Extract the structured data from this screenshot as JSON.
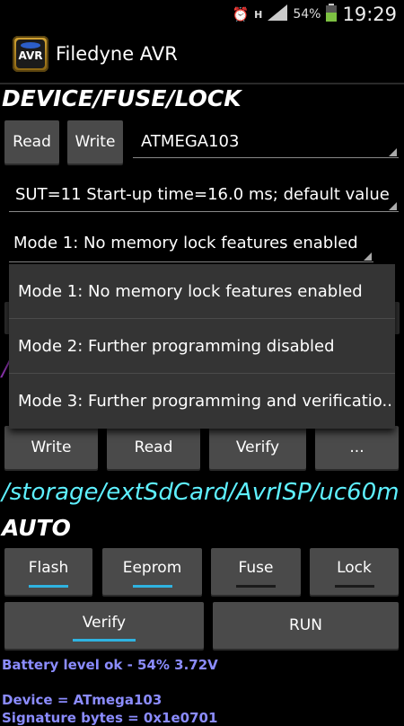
{
  "status": {
    "battery": "54%",
    "time": "19:29"
  },
  "app": {
    "title": "Filedyne AVR",
    "icon_text": "AVR"
  },
  "device_section": {
    "heading": "DEVICE/FUSE/LOCK",
    "read_label": "Read",
    "write_label": "Write",
    "device_selected": "ATMEGA103",
    "fuse_selected": "SUT=11 Start-up time=16.0 ms; default value",
    "lock_selected": "Mode 1: No memory lock features enabled"
  },
  "lock_popup": {
    "options": [
      "Mode 1: No memory lock features enabled",
      "Mode 2: Further programming disabled",
      "Mode 3: Further programming and verificatio.."
    ]
  },
  "file_section": {
    "write_label": "Write",
    "read_label": "Read",
    "verify_label": "Verify",
    "more_label": "...",
    "path": "/storage/extSdCard/AvrISP/uc60m"
  },
  "auto_section": {
    "heading": "AUTO",
    "flash_label": "Flash",
    "eeprom_label": "Eeprom",
    "fuse_label": "Fuse",
    "lock_label": "Lock",
    "verify_label": "Verify",
    "run_label": "RUN"
  },
  "info": {
    "battery_line": "Battery level ok - 54% 3.72V",
    "device_line": "Device = ATmega103",
    "signature_line": "Signature bytes = 0x1e0701"
  },
  "colors": {
    "accent": "#2fb3e0",
    "path": "#5ef0ff",
    "info": "#8b8cff"
  }
}
